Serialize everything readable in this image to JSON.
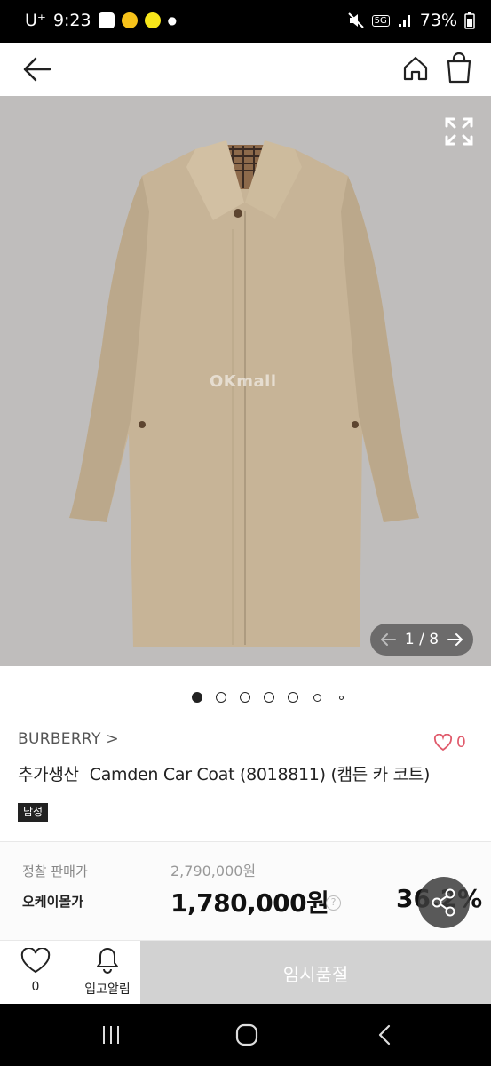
{
  "status_bar": {
    "carrier": "U⁺",
    "time": "9:23",
    "network": "5G",
    "battery": "73%"
  },
  "header": {
    "back_icon": "arrow-left-icon",
    "home_icon": "home-icon",
    "cart_icon": "shopping-bag-icon"
  },
  "gallery": {
    "watermark": "OKmall",
    "pager": {
      "current": "1",
      "separator": "/",
      "total": "8"
    },
    "dot_count": 7,
    "active_dot": 0
  },
  "product": {
    "brand": "BURBERRY",
    "likes": "0",
    "title_prefix": "추가생산",
    "title": "Camden Car Coat (8018811) (캠든 카 코트)",
    "gender_tag": "남성"
  },
  "pricing": {
    "list_label": "정찰 판매가",
    "list_price": "2,790,000원",
    "mall_label": "오케이몰가",
    "sale_price": "1,780,000원",
    "help": "?",
    "discount": "36.2%"
  },
  "bottom_bar": {
    "wish_count": "0",
    "alarm_label": "입고알림",
    "sold_out_label": "임시품절"
  },
  "colors": {
    "heart": "#e05a6b",
    "hero_bg": "#bfbdbc",
    "sold_out_bg": "#d2d2d2"
  }
}
